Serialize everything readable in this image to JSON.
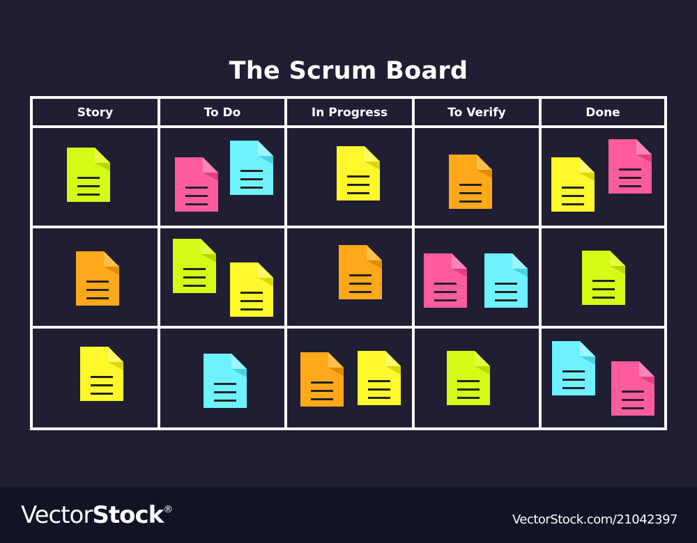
{
  "title": "The Scrum Board",
  "colors": {
    "background": "#1f1e33",
    "grid": "#ffffff",
    "footer": "#121325",
    "line": "#222222",
    "card_lime": {
      "base": "#d4fa16",
      "fold": "#b8d800",
      "fold_light": "#e6ff40"
    },
    "card_pink": {
      "base": "#ff5c9e",
      "fold": "#e0407f",
      "fold_light": "#ff85b8"
    },
    "card_cyan": {
      "base": "#6ef2ff",
      "fold": "#45d2e2",
      "fold_light": "#9cf7ff"
    },
    "card_yellow": {
      "base": "#fff92b",
      "fold": "#dcd60d",
      "fold_light": "#fffb66"
    },
    "card_orange": {
      "base": "#ffa81a",
      "fold": "#e08c00",
      "fold_light": "#ffc04d"
    }
  },
  "columns": [
    {
      "label": "Story"
    },
    {
      "label": "To Do"
    },
    {
      "label": "In Progress"
    },
    {
      "label": "To Verify"
    },
    {
      "label": "Done"
    }
  ],
  "rows": [
    [
      [
        {
          "color": "lime"
        }
      ],
      [
        {
          "color": "pink"
        },
        {
          "color": "cyan"
        }
      ],
      [
        {
          "color": "yellow"
        }
      ],
      [
        {
          "color": "orange"
        }
      ],
      [
        {
          "color": "yellow"
        },
        {
          "color": "pink"
        }
      ]
    ],
    [
      [
        {
          "color": "orange"
        }
      ],
      [
        {
          "color": "lime"
        },
        {
          "color": "yellow"
        }
      ],
      [
        {
          "color": "orange"
        }
      ],
      [
        {
          "color": "pink"
        },
        {
          "color": "cyan"
        }
      ],
      [
        {
          "color": "lime"
        }
      ]
    ],
    [
      [
        {
          "color": "yellow"
        }
      ],
      [
        {
          "color": "cyan"
        }
      ],
      [
        {
          "color": "orange"
        },
        {
          "color": "yellow"
        }
      ],
      [
        {
          "color": "lime"
        }
      ],
      [
        {
          "color": "cyan"
        },
        {
          "color": "pink"
        }
      ]
    ]
  ],
  "footer": {
    "logo_light": "Vector",
    "logo_bold": "Stock",
    "logo_mark": "®",
    "stock_id": "VectorStock.com/21042397"
  }
}
